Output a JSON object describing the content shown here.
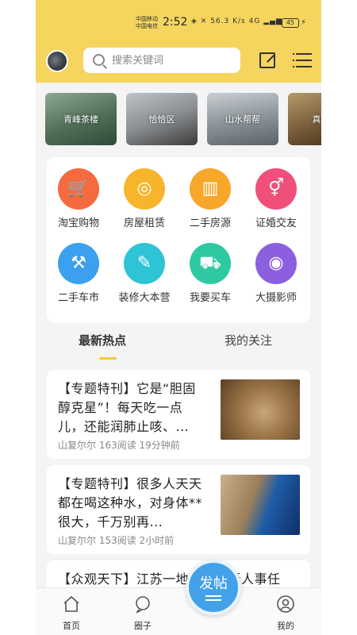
{
  "status": {
    "carrier1": "中国移动",
    "carrier2": "中国电信",
    "time": "2:52",
    "net_speed": "56.3 K/s",
    "signal": "4G",
    "battery": "45"
  },
  "header": {
    "search_placeholder": "搜索关键词"
  },
  "quick_links": [
    {
      "label": "青峰茶楼"
    },
    {
      "label": "恰恰区"
    },
    {
      "label": "山水帮帮"
    },
    {
      "label": "真人S"
    }
  ],
  "categories": [
    {
      "label": "淘宝购物",
      "icon": "cart-icon",
      "color": "#f56a3e"
    },
    {
      "label": "房屋租赁",
      "icon": "coins-icon",
      "color": "#f7b52c"
    },
    {
      "label": "二手房源",
      "icon": "building-icon",
      "color": "#f7a72a"
    },
    {
      "label": "证婚交友",
      "icon": "gender-icon",
      "color": "#f04f7a"
    },
    {
      "label": "二手车市",
      "icon": "gavel-icon",
      "color": "#3aa0ef"
    },
    {
      "label": "装修大本营",
      "icon": "brush-icon",
      "color": "#2fc3d6"
    },
    {
      "label": "我要买车",
      "icon": "car-icon",
      "color": "#2ec9a2"
    },
    {
      "label": "大摄影师",
      "icon": "camera-icon",
      "color": "#8b5fe0"
    }
  ],
  "tabs": [
    {
      "label": "最新热点"
    },
    {
      "label": "我的关注"
    }
  ],
  "articles": [
    {
      "title": "【专题特刊】它是“胆固醇克星”！每天吃一点儿，还能润肺止咳、...",
      "meta": "山复尔尔 163阅读   19分钟前"
    },
    {
      "title": "【专题特刊】很多人天天都在喝这种水，对身体**很大，千万别再...",
      "meta": "山复尔尔 153阅读   2小时前"
    },
    {
      "title": "【众观天下】江苏一地发布最新人事任"
    }
  ],
  "bottom_nav": {
    "home": "首页",
    "circle": "圈子",
    "post": "发帖",
    "mine": "我的"
  },
  "colors": {
    "header": "#f5d55e",
    "accent": "#f5c93a",
    "post_button": "#43a1ea"
  }
}
